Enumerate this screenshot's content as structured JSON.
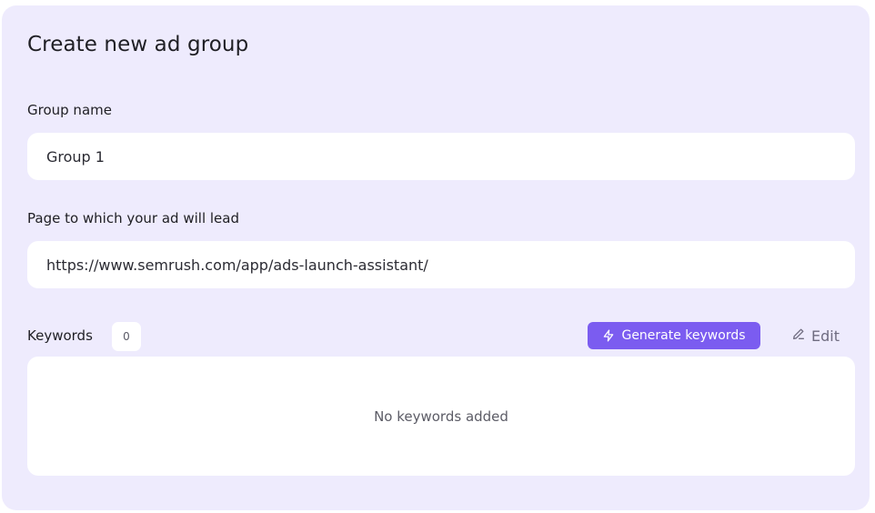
{
  "form": {
    "title": "Create new ad group",
    "group_name": {
      "label": "Group name",
      "value": "Group 1"
    },
    "landing_page": {
      "label": "Page to which your ad will lead",
      "value": "https://www.semrush.com/app/ads-launch-assistant/"
    },
    "keywords": {
      "label": "Keywords",
      "count": "0",
      "generate_label": "Generate keywords",
      "generate_icon": "lightning-icon",
      "edit_label": "Edit",
      "edit_icon": "pencil-icon",
      "empty_text": "No keywords added"
    }
  },
  "colors": {
    "card_bg": "#eeebfd",
    "accent": "#7b5cf0",
    "field_bg": "#ffffff"
  }
}
